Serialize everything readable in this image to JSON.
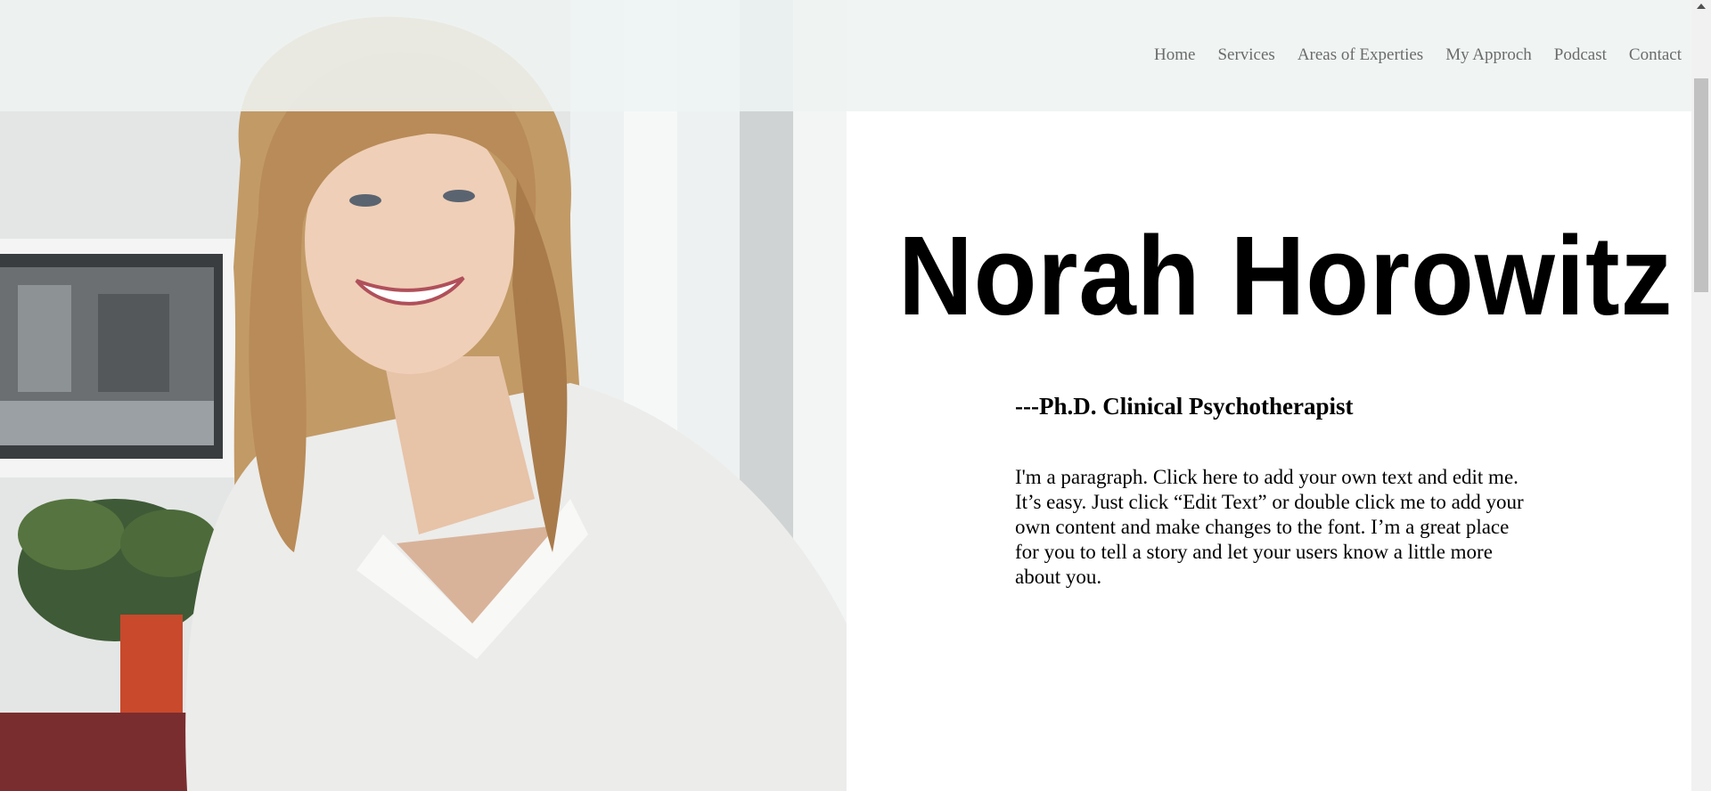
{
  "nav": {
    "items": [
      {
        "label": "Home"
      },
      {
        "label": "Services"
      },
      {
        "label": "Areas of Experties"
      },
      {
        "label": "My Approch"
      },
      {
        "label": "Podcast"
      },
      {
        "label": "Contact"
      }
    ]
  },
  "hero": {
    "name": "Norah Horowitz",
    "subtitle": "---Ph.D. Clinical Psychotherapist",
    "paragraph": "I'm a paragraph. Click here to add your own text and edit me. It’s easy. Just click “Edit Text” or double click me to add your own content and make changes to the font. I’m a great place for you to tell a story and let your users know a little more about you."
  },
  "colors": {
    "header_bg": "#eef4f3",
    "nav_text": "#6b6b6b",
    "heading_text": "#000000",
    "body_bg": "#ffffff"
  },
  "icons": {
    "scroll_up": "scroll-up-arrow-icon"
  }
}
